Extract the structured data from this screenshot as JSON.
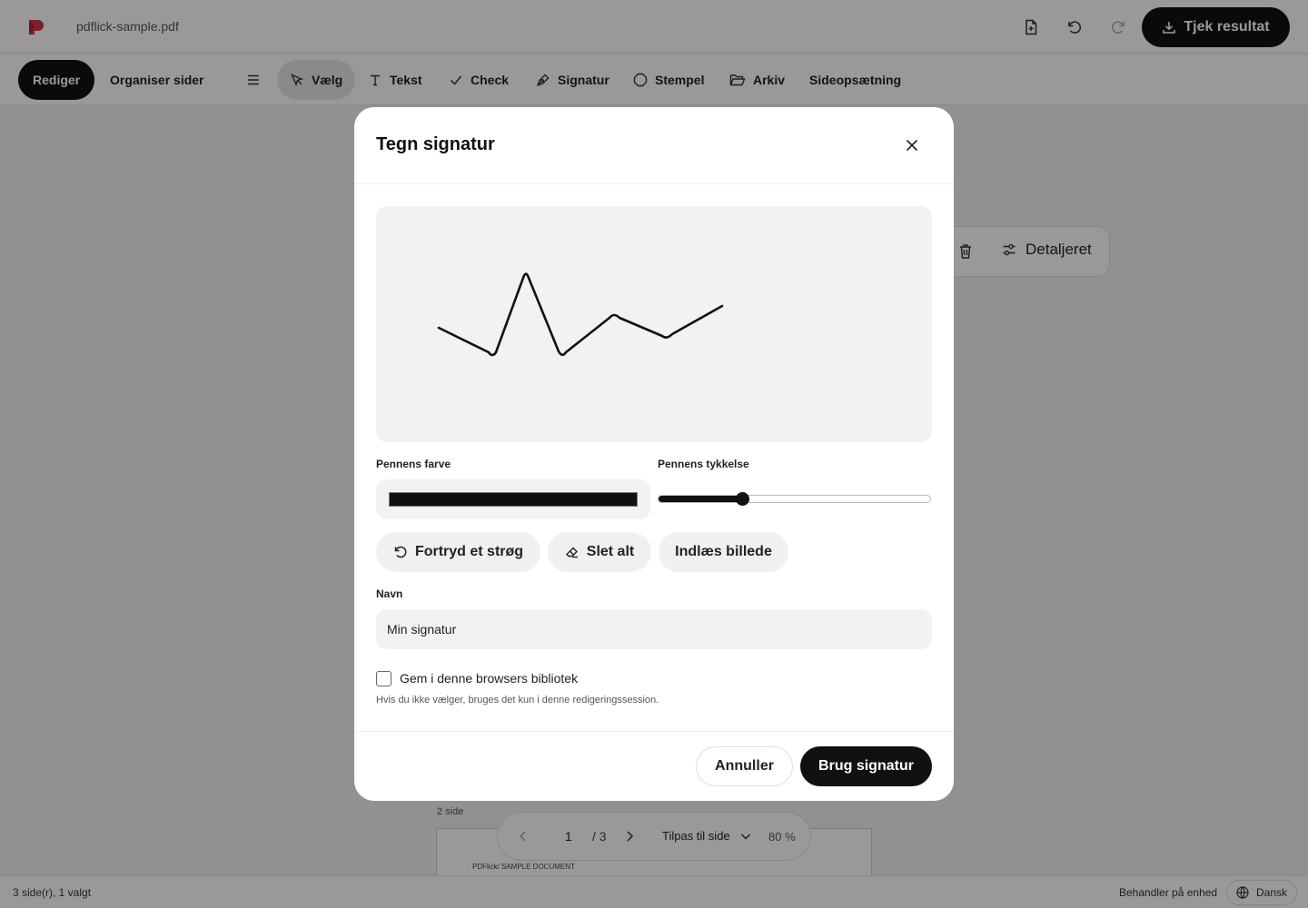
{
  "topbar": {
    "filename": "pdflick-sample.pdf",
    "primary_button": "Tjek resultat",
    "icons": [
      "add-file-icon",
      "undo-icon",
      "redo-icon",
      "download-icon"
    ]
  },
  "toolbar": {
    "mode_tabs": [
      {
        "label": "Rediger",
        "active": true
      },
      {
        "label": "Organiser sider",
        "active": false
      }
    ],
    "tools": [
      {
        "label": "Vælg",
        "icon": "cursor-icon",
        "selected": true
      },
      {
        "label": "Tekst",
        "icon": "text-icon"
      },
      {
        "label": "Check",
        "icon": "check-icon"
      },
      {
        "label": "Signatur",
        "icon": "pen-icon"
      },
      {
        "label": "Stempel",
        "icon": "stamp-icon"
      },
      {
        "label": "Arkiv",
        "icon": "folder-icon"
      },
      {
        "label": "Sideopsætning",
        "icon": ""
      }
    ]
  },
  "side_panel": {
    "detail_label": "Detaljeret"
  },
  "document": {
    "page_label": "2 side",
    "page_header": "PDFlick/ SAMPLE DOCUMENT"
  },
  "pager": {
    "current_page": "1",
    "total_pages": "/ 3",
    "fit_label": "Tilpas til side",
    "zoom": "80 %"
  },
  "statusbar": {
    "pages_info": "3 side(r), 1 valgt",
    "processing": "Behandler på enhed",
    "language": "Dansk"
  },
  "modal": {
    "title": "Tegn signatur",
    "pen_color_label": "Pennens farve",
    "pen_color_value": "#111111",
    "pen_width_label": "Pennens tykkelse",
    "pen_width_fraction": 0.31,
    "undo_stroke": "Fortryd et strøg",
    "clear_all": "Slet alt",
    "load_image": "Indlæs billede",
    "name_label": "Navn",
    "name_value": "Min signatur",
    "save_label": "Gem i denne browsers bibliotek",
    "save_checked": false,
    "hint": "Hvis du ikke vælger, bruges det kun i denne redigeringssession.",
    "cancel": "Annuller",
    "use": "Brug signatur"
  },
  "colors": {
    "accent": "#111111",
    "logo": "#d6334a"
  }
}
